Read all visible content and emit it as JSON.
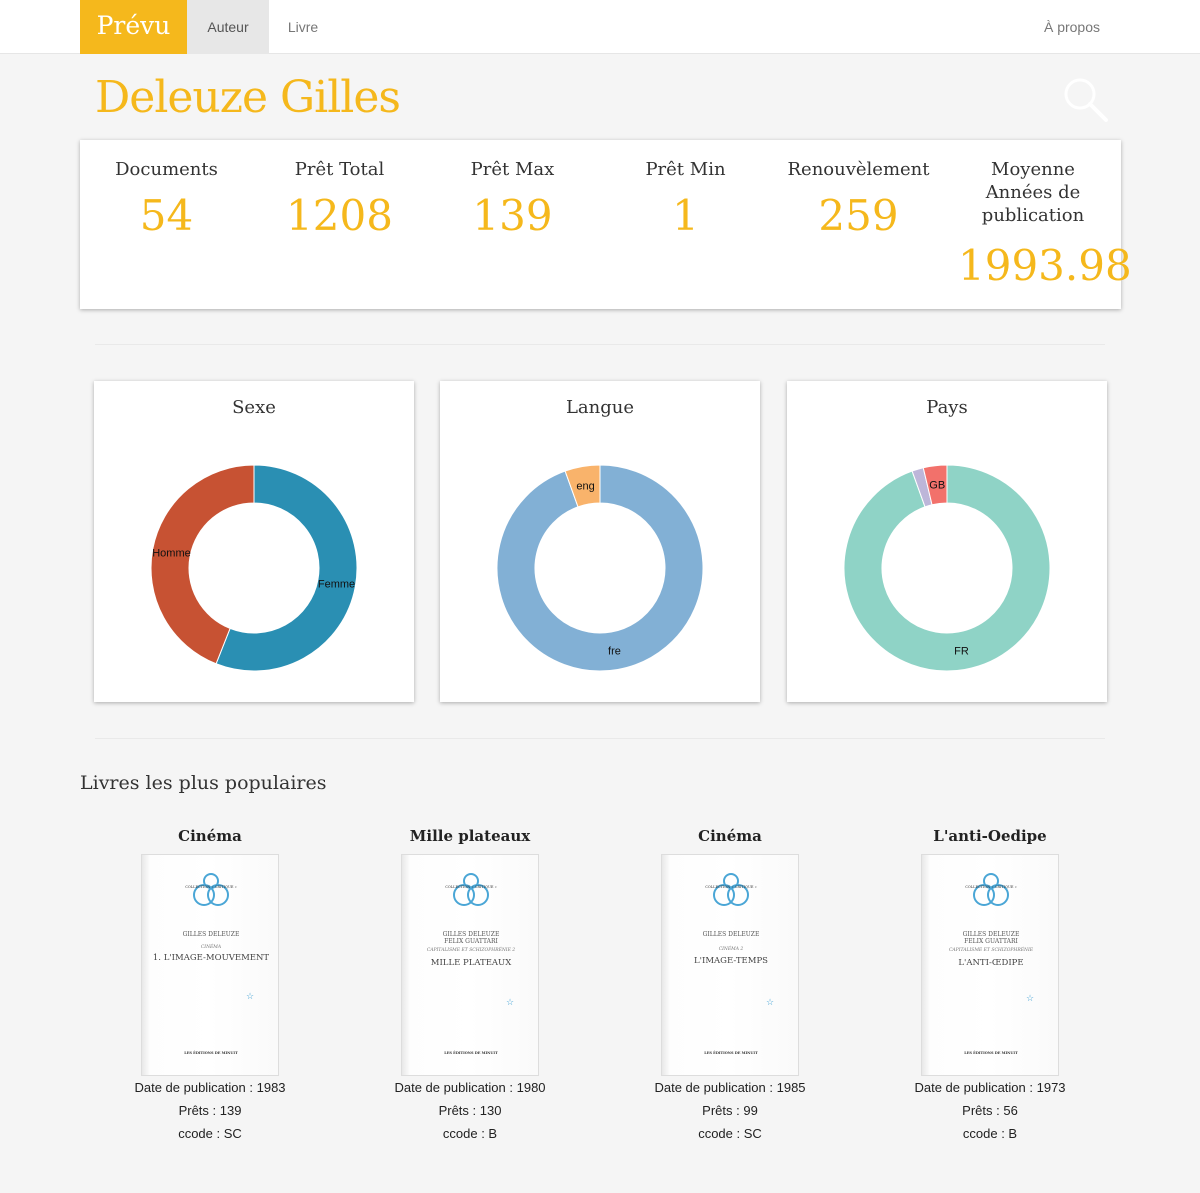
{
  "nav": {
    "brand": "Prévu",
    "items": [
      {
        "label": "Auteur"
      },
      {
        "label": "Livre"
      }
    ],
    "about": "À propos"
  },
  "author": {
    "name": "Deleuze Gilles"
  },
  "stats": [
    {
      "label": "Documents",
      "value": "54"
    },
    {
      "label": "Prêt Total",
      "value": "1208"
    },
    {
      "label": "Prêt Max",
      "value": "139"
    },
    {
      "label": "Prêt Min",
      "value": "1"
    },
    {
      "label": "Renouvèlement",
      "value": "259"
    },
    {
      "label": "Moyenne Années de publication",
      "value": "1993.98"
    }
  ],
  "chart_data": [
    {
      "type": "pie",
      "title": "Sexe",
      "categories": [
        "Femme",
        "Homme"
      ],
      "values": [
        56,
        44
      ],
      "colors": [
        "#2a8fb3",
        "#c75233"
      ]
    },
    {
      "type": "pie",
      "title": "Langue",
      "categories": [
        "fre",
        "eng"
      ],
      "values": [
        94.5,
        5.5
      ],
      "colors": [
        "#82b0d5",
        "#f9b36b"
      ]
    },
    {
      "type": "pie",
      "title": "Pays",
      "categories": [
        "FR",
        "",
        "GB"
      ],
      "values": [
        94.5,
        1.8,
        3.7
      ],
      "colors": [
        "#8fd3c6",
        "#bdb6d9",
        "#f2716b"
      ]
    }
  ],
  "popular": {
    "title": "Livres les plus populaires",
    "books": [
      {
        "title": "Cinéma",
        "date": "Date de publication : 1983",
        "prets": "Prêts : 139",
        "ccode": "ccode : SC",
        "cover": {
          "collection": "COLLECTION « CRITIQUE »",
          "authors": "GILLES DELEUZE",
          "subtitle": "CINÉMA",
          "main": "1. L'IMAGE-MOUVEMENT",
          "publisher": "LES ÉDITIONS DE MINUIT"
        }
      },
      {
        "title": "Mille plateaux",
        "date": "Date de publication : 1980",
        "prets": "Prêts : 130",
        "ccode": "ccode : B",
        "cover": {
          "collection": "COLLECTION « CRITIQUE »",
          "authors": "GILLES DELEUZE\nFELIX GUATTARI",
          "subtitle": "CAPITALISME ET SCHIZOPHRÉNIE 2",
          "main": "MILLE PLATEAUX",
          "publisher": "LES ÉDITIONS DE MINUIT"
        }
      },
      {
        "title": "Cinéma",
        "date": "Date de publication : 1985",
        "prets": "Prêts : 99",
        "ccode": "ccode : SC",
        "cover": {
          "collection": "COLLECTION « CRITIQUE »",
          "authors": "GILLES DELEUZE",
          "subtitle": "CINÉMA 2",
          "main": "L'IMAGE-TEMPS",
          "publisher": "LES ÉDITIONS DE MINUIT"
        }
      },
      {
        "title": "L'anti-Oedipe",
        "date": "Date de publication : 1973",
        "prets": "Prêts : 56",
        "ccode": "ccode : B",
        "cover": {
          "collection": "COLLECTION « CRITIQUE »",
          "authors": "GILLES DELEUZE\nFELIX GUATTARI",
          "subtitle": "CAPITALISME ET SCHIZOPHRÉNIE",
          "main": "L'ANTI-ŒDIPE",
          "publisher": "LES ÉDITIONS DE MINUIT"
        }
      }
    ]
  },
  "colors": {
    "accent": "#f5b81c",
    "background": "#f5f5f5"
  }
}
